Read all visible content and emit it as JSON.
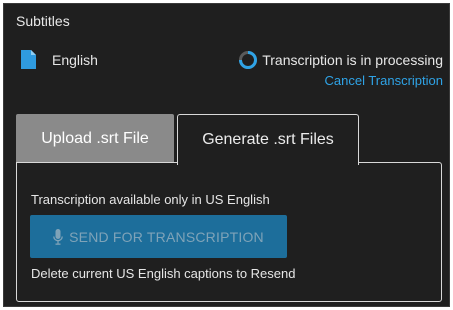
{
  "panel": {
    "title": "Subtitles"
  },
  "language": {
    "icon": "file-icon",
    "label": "English"
  },
  "status": {
    "icon": "spinner-icon",
    "text": "Transcription is in processing",
    "cancel_label": "Cancel Transcription"
  },
  "tabs": [
    {
      "label": "Upload .srt File",
      "selected": false
    },
    {
      "label": "Generate .srt Files",
      "selected": true
    }
  ],
  "generate": {
    "info_text": "Transcription available only in US English",
    "send_button_label": "SEND FOR TRANSCRIPTION",
    "send_button_icon": "microphone-icon",
    "send_button_disabled": true,
    "delete_text": "Delete current US English captions to Resend"
  },
  "colors": {
    "panel_bg": "#1f1f1f",
    "accent_link": "#2fa3e6",
    "file_icon": "#2f9be0",
    "button_bg": "#1d6e9b",
    "button_text": "#7fa3b8",
    "tab_inactive_bg": "#8a8a8a"
  }
}
